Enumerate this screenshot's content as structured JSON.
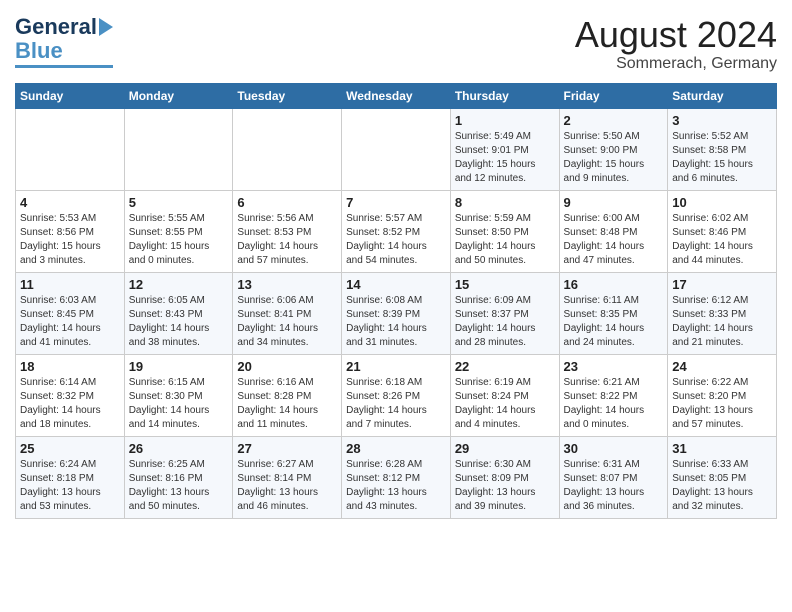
{
  "header": {
    "logo_line1": "General",
    "logo_line2": "Blue",
    "month": "August 2024",
    "location": "Sommerach, Germany"
  },
  "days_of_week": [
    "Sunday",
    "Monday",
    "Tuesday",
    "Wednesday",
    "Thursday",
    "Friday",
    "Saturday"
  ],
  "weeks": [
    [
      {
        "day": "",
        "info": ""
      },
      {
        "day": "",
        "info": ""
      },
      {
        "day": "",
        "info": ""
      },
      {
        "day": "",
        "info": ""
      },
      {
        "day": "1",
        "info": "Sunrise: 5:49 AM\nSunset: 9:01 PM\nDaylight: 15 hours\nand 12 minutes."
      },
      {
        "day": "2",
        "info": "Sunrise: 5:50 AM\nSunset: 9:00 PM\nDaylight: 15 hours\nand 9 minutes."
      },
      {
        "day": "3",
        "info": "Sunrise: 5:52 AM\nSunset: 8:58 PM\nDaylight: 15 hours\nand 6 minutes."
      }
    ],
    [
      {
        "day": "4",
        "info": "Sunrise: 5:53 AM\nSunset: 8:56 PM\nDaylight: 15 hours\nand 3 minutes."
      },
      {
        "day": "5",
        "info": "Sunrise: 5:55 AM\nSunset: 8:55 PM\nDaylight: 15 hours\nand 0 minutes."
      },
      {
        "day": "6",
        "info": "Sunrise: 5:56 AM\nSunset: 8:53 PM\nDaylight: 14 hours\nand 57 minutes."
      },
      {
        "day": "7",
        "info": "Sunrise: 5:57 AM\nSunset: 8:52 PM\nDaylight: 14 hours\nand 54 minutes."
      },
      {
        "day": "8",
        "info": "Sunrise: 5:59 AM\nSunset: 8:50 PM\nDaylight: 14 hours\nand 50 minutes."
      },
      {
        "day": "9",
        "info": "Sunrise: 6:00 AM\nSunset: 8:48 PM\nDaylight: 14 hours\nand 47 minutes."
      },
      {
        "day": "10",
        "info": "Sunrise: 6:02 AM\nSunset: 8:46 PM\nDaylight: 14 hours\nand 44 minutes."
      }
    ],
    [
      {
        "day": "11",
        "info": "Sunrise: 6:03 AM\nSunset: 8:45 PM\nDaylight: 14 hours\nand 41 minutes."
      },
      {
        "day": "12",
        "info": "Sunrise: 6:05 AM\nSunset: 8:43 PM\nDaylight: 14 hours\nand 38 minutes."
      },
      {
        "day": "13",
        "info": "Sunrise: 6:06 AM\nSunset: 8:41 PM\nDaylight: 14 hours\nand 34 minutes."
      },
      {
        "day": "14",
        "info": "Sunrise: 6:08 AM\nSunset: 8:39 PM\nDaylight: 14 hours\nand 31 minutes."
      },
      {
        "day": "15",
        "info": "Sunrise: 6:09 AM\nSunset: 8:37 PM\nDaylight: 14 hours\nand 28 minutes."
      },
      {
        "day": "16",
        "info": "Sunrise: 6:11 AM\nSunset: 8:35 PM\nDaylight: 14 hours\nand 24 minutes."
      },
      {
        "day": "17",
        "info": "Sunrise: 6:12 AM\nSunset: 8:33 PM\nDaylight: 14 hours\nand 21 minutes."
      }
    ],
    [
      {
        "day": "18",
        "info": "Sunrise: 6:14 AM\nSunset: 8:32 PM\nDaylight: 14 hours\nand 18 minutes."
      },
      {
        "day": "19",
        "info": "Sunrise: 6:15 AM\nSunset: 8:30 PM\nDaylight: 14 hours\nand 14 minutes."
      },
      {
        "day": "20",
        "info": "Sunrise: 6:16 AM\nSunset: 8:28 PM\nDaylight: 14 hours\nand 11 minutes."
      },
      {
        "day": "21",
        "info": "Sunrise: 6:18 AM\nSunset: 8:26 PM\nDaylight: 14 hours\nand 7 minutes."
      },
      {
        "day": "22",
        "info": "Sunrise: 6:19 AM\nSunset: 8:24 PM\nDaylight: 14 hours\nand 4 minutes."
      },
      {
        "day": "23",
        "info": "Sunrise: 6:21 AM\nSunset: 8:22 PM\nDaylight: 14 hours\nand 0 minutes."
      },
      {
        "day": "24",
        "info": "Sunrise: 6:22 AM\nSunset: 8:20 PM\nDaylight: 13 hours\nand 57 minutes."
      }
    ],
    [
      {
        "day": "25",
        "info": "Sunrise: 6:24 AM\nSunset: 8:18 PM\nDaylight: 13 hours\nand 53 minutes."
      },
      {
        "day": "26",
        "info": "Sunrise: 6:25 AM\nSunset: 8:16 PM\nDaylight: 13 hours\nand 50 minutes."
      },
      {
        "day": "27",
        "info": "Sunrise: 6:27 AM\nSunset: 8:14 PM\nDaylight: 13 hours\nand 46 minutes."
      },
      {
        "day": "28",
        "info": "Sunrise: 6:28 AM\nSunset: 8:12 PM\nDaylight: 13 hours\nand 43 minutes."
      },
      {
        "day": "29",
        "info": "Sunrise: 6:30 AM\nSunset: 8:09 PM\nDaylight: 13 hours\nand 39 minutes."
      },
      {
        "day": "30",
        "info": "Sunrise: 6:31 AM\nSunset: 8:07 PM\nDaylight: 13 hours\nand 36 minutes."
      },
      {
        "day": "31",
        "info": "Sunrise: 6:33 AM\nSunset: 8:05 PM\nDaylight: 13 hours\nand 32 minutes."
      }
    ]
  ]
}
